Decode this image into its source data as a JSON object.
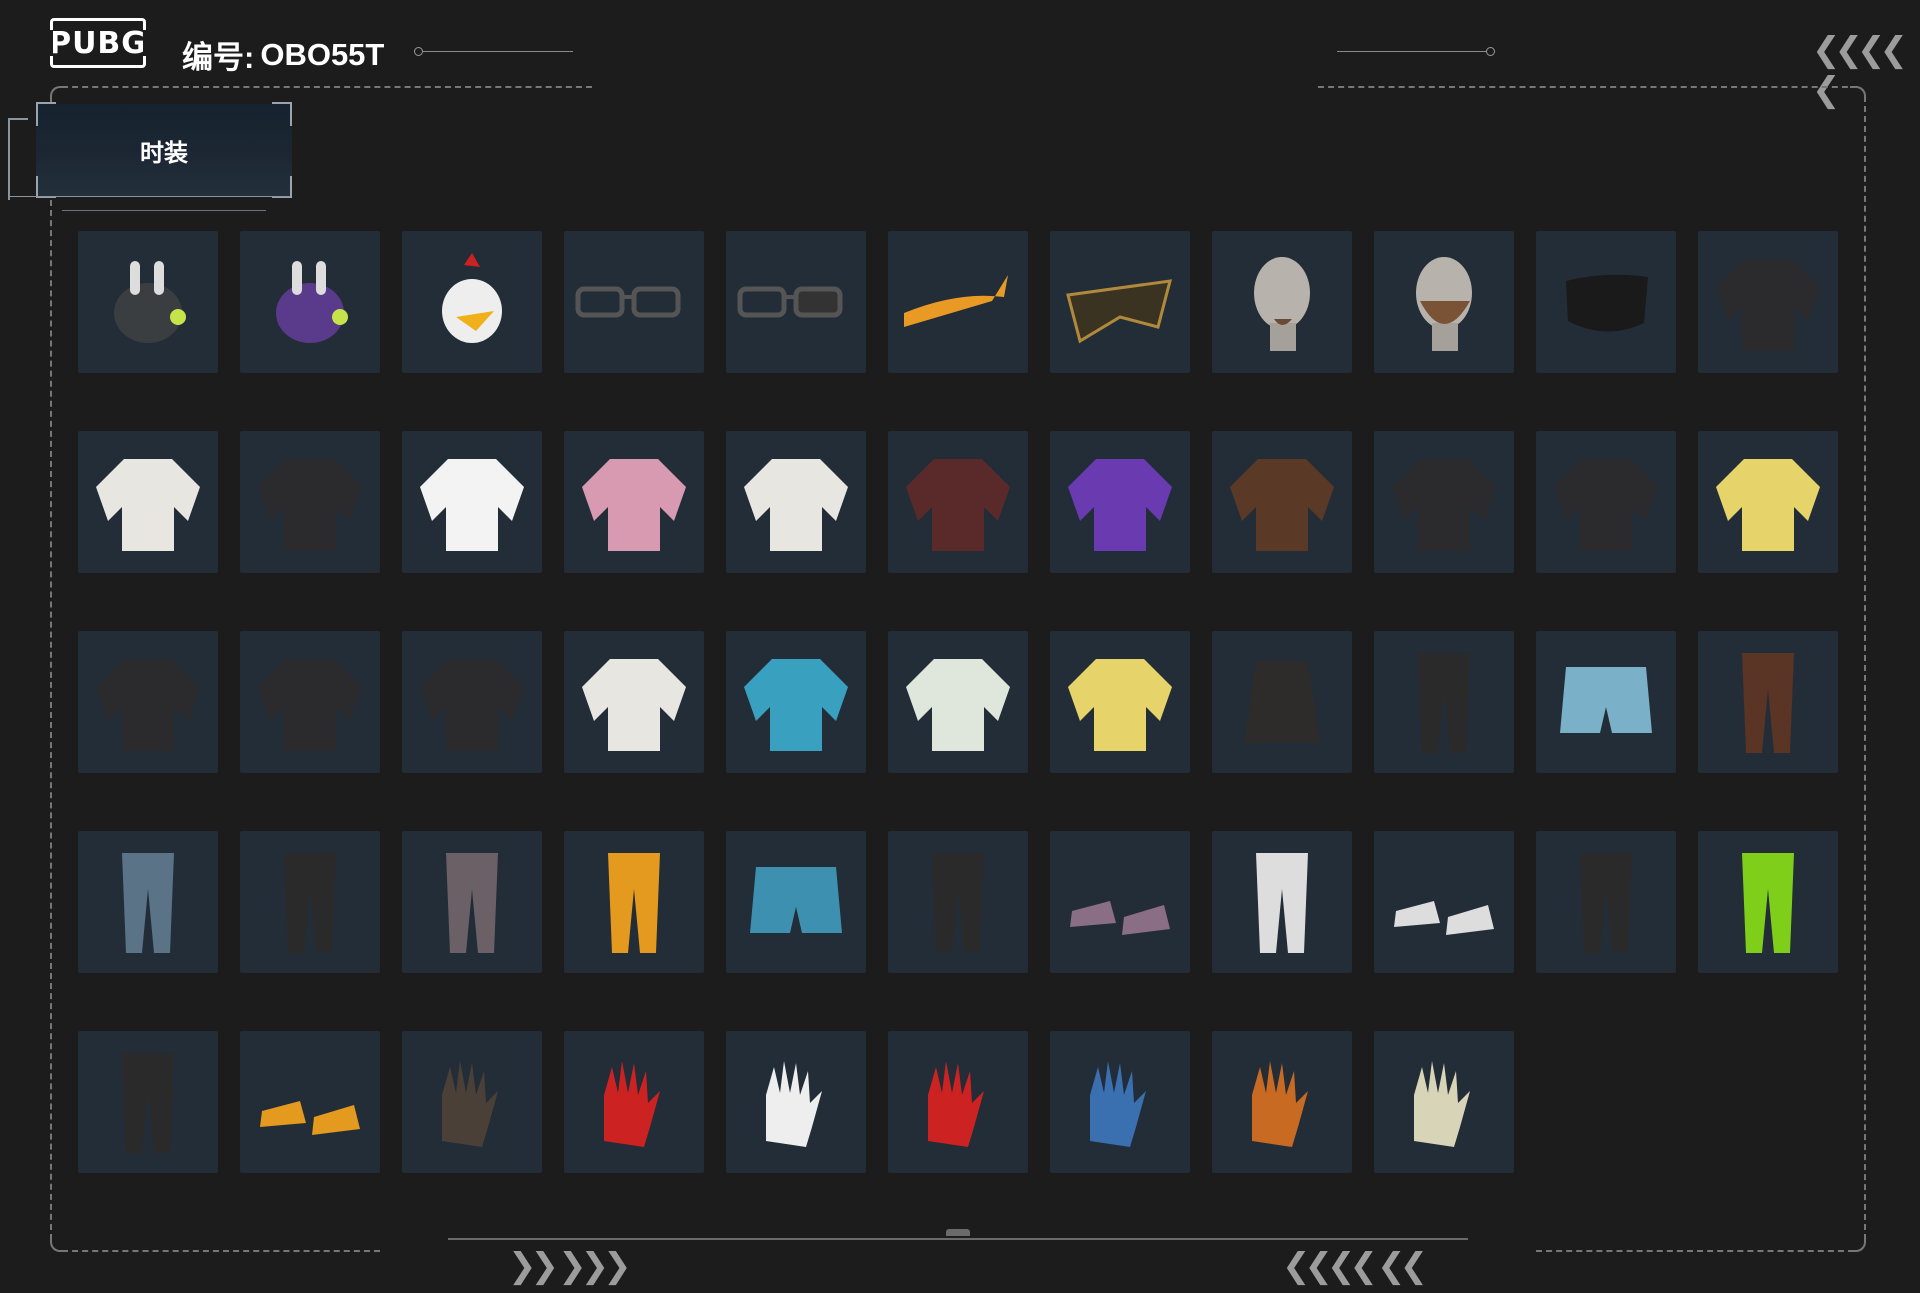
{
  "header": {
    "logo_text": "PUBG",
    "serial_label": "编号:",
    "serial_value": "OBO55T"
  },
  "tab": {
    "label": "时装"
  },
  "colors": {
    "background": "#1c1c1d",
    "tile": "#232d38",
    "frame": "#777777",
    "tab_bg": "#1c2733"
  },
  "items": [
    {
      "name": "bunny-ear-helmet-icon"
    },
    {
      "name": "purple-space-bunny-helmet-icon"
    },
    {
      "name": "chicken-mask-icon"
    },
    {
      "name": "clear-glasses-icon"
    },
    {
      "name": "dark-sunglasses-icon"
    },
    {
      "name": "orange-bandana-icon"
    },
    {
      "name": "gold-horned-mask-icon"
    },
    {
      "name": "goatee-head-icon"
    },
    {
      "name": "full-beard-head-icon"
    },
    {
      "name": "black-face-mask-icon"
    },
    {
      "name": "shark-teeth-mask-icon"
    },
    {
      "name": "white-shirt-vest-icon"
    },
    {
      "name": "black-turtleneck-icon"
    },
    {
      "name": "pikachu-tshirt-icon"
    },
    {
      "name": "pink-fur-coat-dress-icon"
    },
    {
      "name": "white-blazer-icon"
    },
    {
      "name": "red-hooded-outfit-icon"
    },
    {
      "name": "purple-racing-top-icon"
    },
    {
      "name": "brown-leather-vest-icon"
    },
    {
      "name": "tattoo-arm-shirt-icon"
    },
    {
      "name": "baseball-outfit-icon"
    },
    {
      "name": "yellow-fluffy-sweater-icon"
    },
    {
      "name": "leather-vest-jacket-icon"
    },
    {
      "name": "black-leather-jacket-icon"
    },
    {
      "name": "black-hoodie-icon"
    },
    {
      "name": "white-orange-jacket-icon"
    },
    {
      "name": "blue-bunny-hoodie-icon"
    },
    {
      "name": "green-leaf-hoodie-icon"
    },
    {
      "name": "yellow-puffer-vest-icon"
    },
    {
      "name": "black-studded-skirt-icon"
    },
    {
      "name": "black-pants-icon"
    },
    {
      "name": "denim-shorts-icon"
    },
    {
      "name": "brown-pants-icon"
    },
    {
      "name": "blue-jeans-icon"
    },
    {
      "name": "black-cargo-pants-icon"
    },
    {
      "name": "camo-pants-icon"
    },
    {
      "name": "orange-pants-icon"
    },
    {
      "name": "teal-swim-shorts-icon"
    },
    {
      "name": "tall-lace-boots-icon"
    },
    {
      "name": "purple-stockings-sneakers-icon"
    },
    {
      "name": "white-stockings-boots-icon"
    },
    {
      "name": "white-dress-shoes-icon"
    },
    {
      "name": "black-ankle-boots-icon"
    },
    {
      "name": "green-leg-warmers-icon"
    },
    {
      "name": "fur-trim-boots-icon"
    },
    {
      "name": "orange-sneakers-icon"
    },
    {
      "name": "skeleton-gloves-icon"
    },
    {
      "name": "white-hand-red-nails-icon"
    },
    {
      "name": "white-fingerless-gloves-icon"
    },
    {
      "name": "red-moto-gloves-icon"
    },
    {
      "name": "blue-fingerless-gloves-icon"
    },
    {
      "name": "orange-tactical-gloves-icon"
    },
    {
      "name": "yellow-work-gloves-icon"
    }
  ]
}
